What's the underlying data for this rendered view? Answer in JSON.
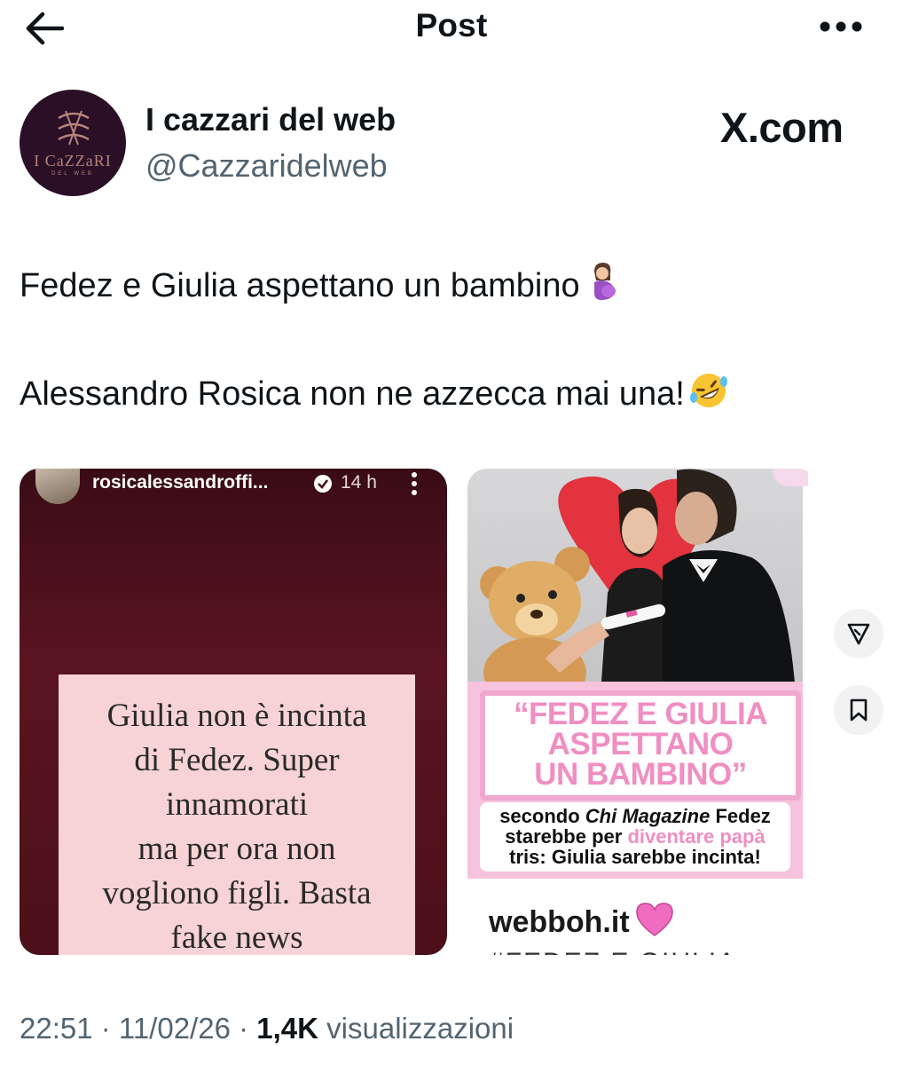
{
  "header": {
    "title": "Post"
  },
  "author": {
    "name": "I cazzari del web",
    "handle": "@Cazzaridelweb",
    "avatar_brand": "I CaZZaRI",
    "avatar_sub": "DEL WEB"
  },
  "watermark": "X.com",
  "tweet": {
    "line1": "Fedez e Giulia aspettano un bambino",
    "line2": "Alessandro Rosica non ne azzecca mai una!"
  },
  "media": {
    "story": {
      "username": "rosicalessandroffi...",
      "time": "14 h",
      "text_lines": [
        "Giulia non è incinta",
        "di Fedez. Super",
        "innamorati",
        "ma per ora non",
        "vogliono figli. Basta",
        "fake news"
      ]
    },
    "article": {
      "headline_lines": [
        "“FEDEZ E GIULIA",
        "ASPETTANO",
        "UN BAMBINO”"
      ],
      "sub_1": "secondo ",
      "sub_italic": "Chi Magazine",
      "sub_2": " Fedez",
      "sub_3": "starebbe per ",
      "sub_pink": "diventare papà",
      "sub_4": "tris: Giulia sarebbe incinta!",
      "site": "webboh.it",
      "cut_text": "#FEDEZ E GIULIA"
    }
  },
  "footer": {
    "time": "22:51",
    "sep1": " · ",
    "date": "11/02/26",
    "sep2": " · ",
    "views_count": "1,4K",
    "views_label": " visualizzazioni"
  },
  "colors": {
    "text": "#0f1419",
    "secondary": "#536471",
    "story_bg": "#4c1018",
    "story_card": "#f7d3d5",
    "headline_pink": "#f08ec2"
  },
  "icons": [
    "back-arrow-icon",
    "more-icon",
    "pregnant-woman-emoji-icon",
    "rofl-emoji-icon",
    "verified-badge-icon",
    "story-menu-icon",
    "pink-heart-icon",
    "grok-icon",
    "bookmark-icon"
  ]
}
